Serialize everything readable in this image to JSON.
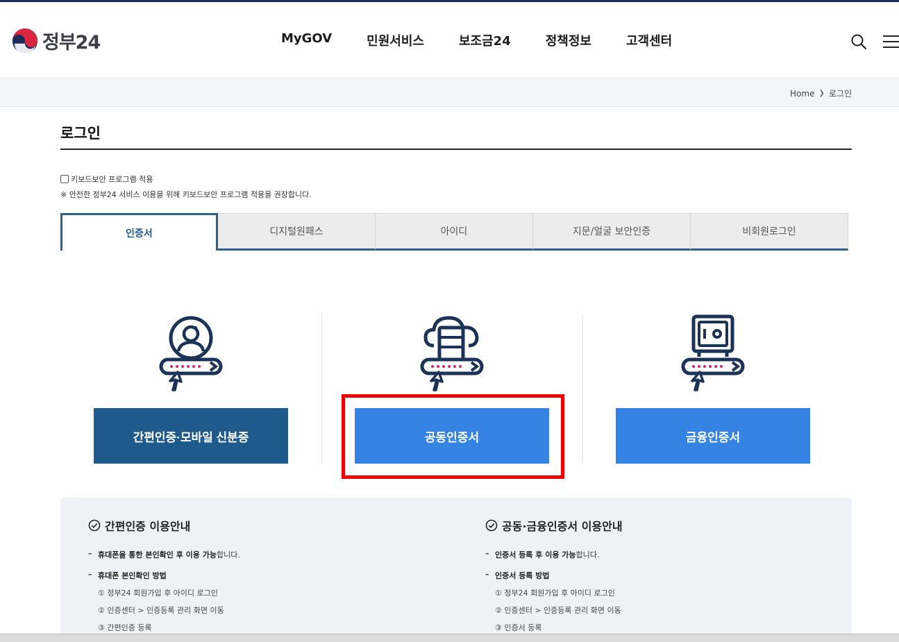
{
  "header": {
    "logo_text": "정부24",
    "nav": [
      "MyGOV",
      "민원서비스",
      "보조금24",
      "정책정보",
      "고객센터"
    ],
    "icons": [
      "search-icon",
      "menu-icon"
    ]
  },
  "breadcrumb": {
    "home": "Home",
    "current": "로그인"
  },
  "page": {
    "title": "로그인"
  },
  "keyboard_security": {
    "label": "키보드보안 프로그램 적용",
    "checked": false,
    "note": "※ 안전한 정부24 서비스 이용을 위해 키보드보안 프로그램 적용을 권장합니다."
  },
  "tabs": [
    {
      "label": "인증서",
      "active": true
    },
    {
      "label": "디지털원패스",
      "active": false
    },
    {
      "label": "아이디",
      "active": false
    },
    {
      "label": "지문/얼굴 보안인증",
      "active": false
    },
    {
      "label": "비회원로그인",
      "active": false
    }
  ],
  "login_options": [
    {
      "icon": "person-login-icon",
      "label": "간편인증·모바일 신분증"
    },
    {
      "icon": "cloud-certificate-icon",
      "label": "공동인증서"
    },
    {
      "icon": "safe-certificate-icon",
      "label": "금융인증서"
    }
  ],
  "info": {
    "left": {
      "title": "간편인증 이용안내",
      "line1_bold": "휴대폰을 통한 본인확인 후 이용 가능",
      "line1_rest": "합니다.",
      "line2": "휴대폰 본인확인 방법",
      "steps": [
        "① 정부24 회원가입 후 아이디 로그인",
        "② 인증센터 > 인증등록 관리 화면 이동",
        "③ 간편인증 등록"
      ]
    },
    "right": {
      "title": "공동·금융인증서 이용안내",
      "line1_bold": "인증서 등록 후 이용 가능",
      "line1_rest": "합니다.",
      "line2": "인증서 등록 방법",
      "steps": [
        "① 정부24 회원가입 후 아이디 로그인",
        "② 인증센터 > 인증등록 관리 화면 이동",
        "③ 인증서 등록"
      ]
    }
  },
  "colors": {
    "brand_dark": "#1f5a8c",
    "brand_blue": "#3584e4",
    "highlight": "#ee0000",
    "navy": "#1c2b5a"
  }
}
